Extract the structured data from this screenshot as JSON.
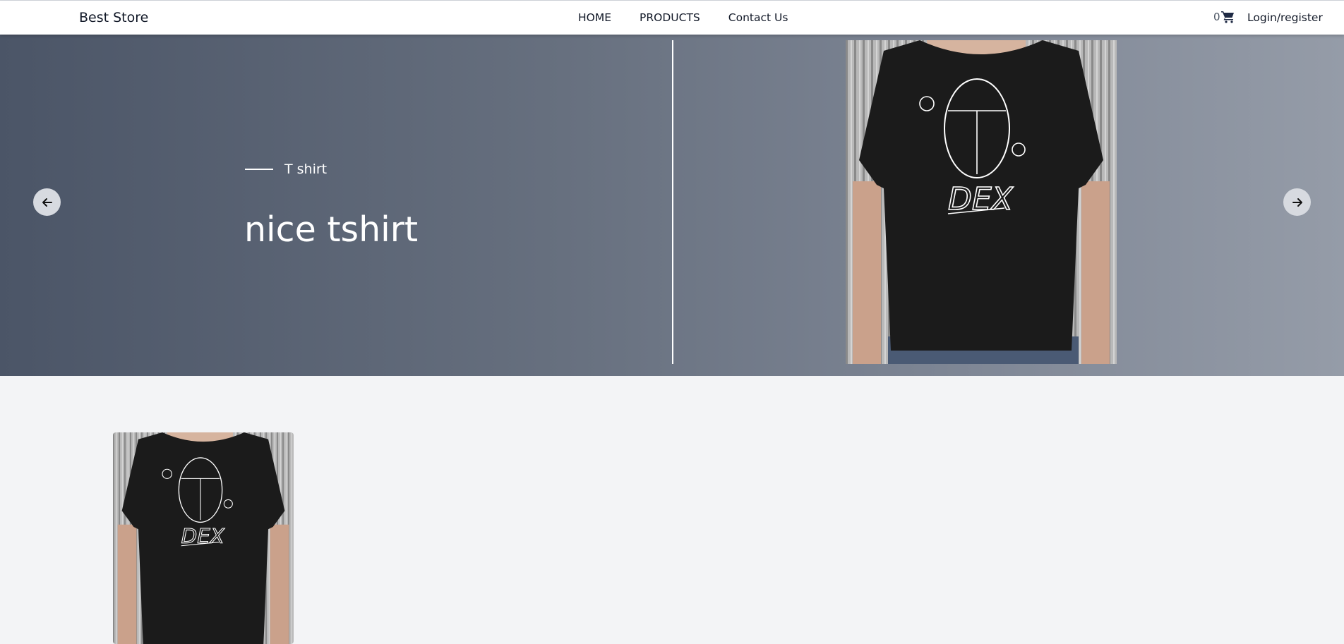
{
  "nav": {
    "brand": "Best Store",
    "links": [
      "HOME",
      "PRODUCTS",
      "Contact Us"
    ],
    "cart_count": "0",
    "cart_icon": "cart-icon",
    "login": "Login/register"
  },
  "hero": {
    "subtitle": "T shirt",
    "title": "nice tshirt",
    "prev_icon": "arrow-left-icon",
    "next_icon": "arrow-right-icon",
    "shirt_text": "DEX"
  },
  "products": [
    {
      "image": "tshirt-image",
      "shirt_text": "DEX"
    }
  ],
  "colors": {
    "hero_gradient_start": "#4b5567",
    "hero_gradient_end": "#959ca8",
    "page_background": "#f3f4f6",
    "shirt": "#1b1b1b"
  }
}
